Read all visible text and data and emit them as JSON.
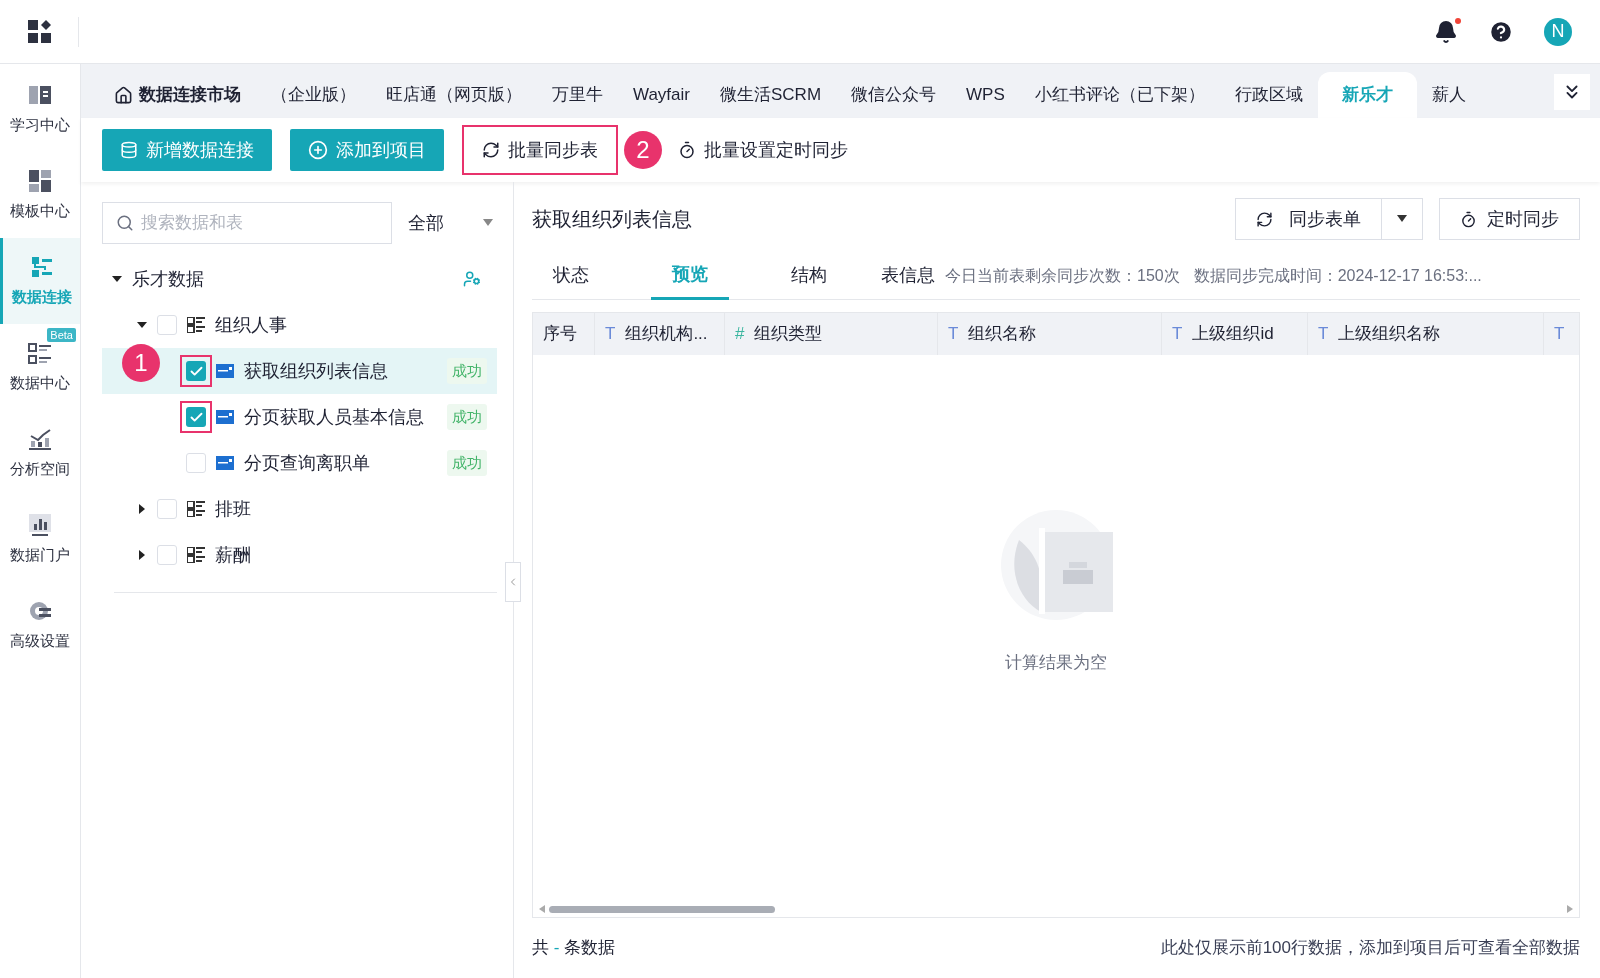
{
  "top_bar": {
    "notification_dot": true,
    "avatar": "N"
  },
  "sidebar": {
    "items": [
      {
        "label": "学习中心",
        "selected": false
      },
      {
        "label": "模板中心",
        "selected": false
      },
      {
        "label": "数据连接",
        "selected": true
      },
      {
        "label": "数据中心",
        "selected": false,
        "badge": "Beta"
      },
      {
        "label": "分析空间",
        "selected": false
      },
      {
        "label": "数据门户",
        "selected": false
      },
      {
        "label": "高级设置",
        "selected": false
      }
    ]
  },
  "tabs": [
    {
      "label": "数据连接市场",
      "kind": "home",
      "selected": false
    },
    {
      "label": "（企业版）",
      "selected": false
    },
    {
      "label": "旺店通（网页版）",
      "selected": false
    },
    {
      "label": "万里牛",
      "selected": false
    },
    {
      "label": "Wayfair",
      "selected": false
    },
    {
      "label": "微生活SCRM",
      "selected": false
    },
    {
      "label": "微信公众号",
      "selected": false
    },
    {
      "label": "WPS",
      "selected": false
    },
    {
      "label": "小红书评论（已下架）",
      "selected": false
    },
    {
      "label": "行政区域",
      "selected": false
    },
    {
      "label": "新乐才",
      "selected": true
    },
    {
      "label": "薪人",
      "selected": false
    }
  ],
  "toolbar": {
    "buttons": [
      {
        "label": "新增数据连接",
        "kind": "primary",
        "highlighted": false
      },
      {
        "label": "添加到项目",
        "kind": "primary",
        "highlighted": false
      },
      {
        "label": "批量同步表",
        "kind": "plain",
        "highlighted": true,
        "annotation": "2"
      },
      {
        "label": "批量设置定时同步",
        "kind": "plain",
        "highlighted": false
      }
    ]
  },
  "tree": {
    "search": {
      "placeholder": "搜索数据和表"
    },
    "filter": "全部",
    "root": {
      "label": "乐才数据",
      "expanded": true,
      "children": [
        {
          "label": "组织人事",
          "checked": false,
          "expanded": true,
          "children": [
            {
              "label": "获取组织列表信息",
              "checked": true,
              "selected": true,
              "status": "成功",
              "annotation": "1"
            },
            {
              "label": "分页获取人员基本信息",
              "checked": true,
              "selected": false,
              "status": "成功"
            },
            {
              "label": "分页查询离职单",
              "checked": false,
              "selected": false,
              "status": "成功"
            }
          ]
        },
        {
          "label": "排班",
          "checked": false,
          "expanded": false
        },
        {
          "label": "薪酬",
          "checked": false,
          "expanded": false
        }
      ]
    }
  },
  "detail": {
    "title": "获取组织列表信息",
    "sync_button": "同步表单",
    "schedule_button": "定时同步",
    "tabs": [
      {
        "label": "状态",
        "selected": false
      },
      {
        "label": "预览",
        "selected": true
      },
      {
        "label": "结构",
        "selected": false
      }
    ],
    "info_label": "表信息",
    "info_remaining": "今日当前表剩余同步次数：150次",
    "info_time": "数据同步完成时间：2024-12-17 16:53:...",
    "columns": [
      {
        "label": "序号"
      },
      {
        "type": "T",
        "label": "组织机构..."
      },
      {
        "type": "#",
        "label": "组织类型"
      },
      {
        "type": "T",
        "label": "组织名称"
      },
      {
        "type": "T",
        "label": "上级组织id"
      },
      {
        "type": "T",
        "label": "上级组织名称"
      },
      {
        "type": "T"
      }
    ],
    "empty_text": "计算结果为空",
    "footer": {
      "total_prefix": "共",
      "total_count": "-",
      "total_suffix": "条数据",
      "note": "此处仅展示前100行数据，添加到项目后可查看全部数据"
    }
  }
}
